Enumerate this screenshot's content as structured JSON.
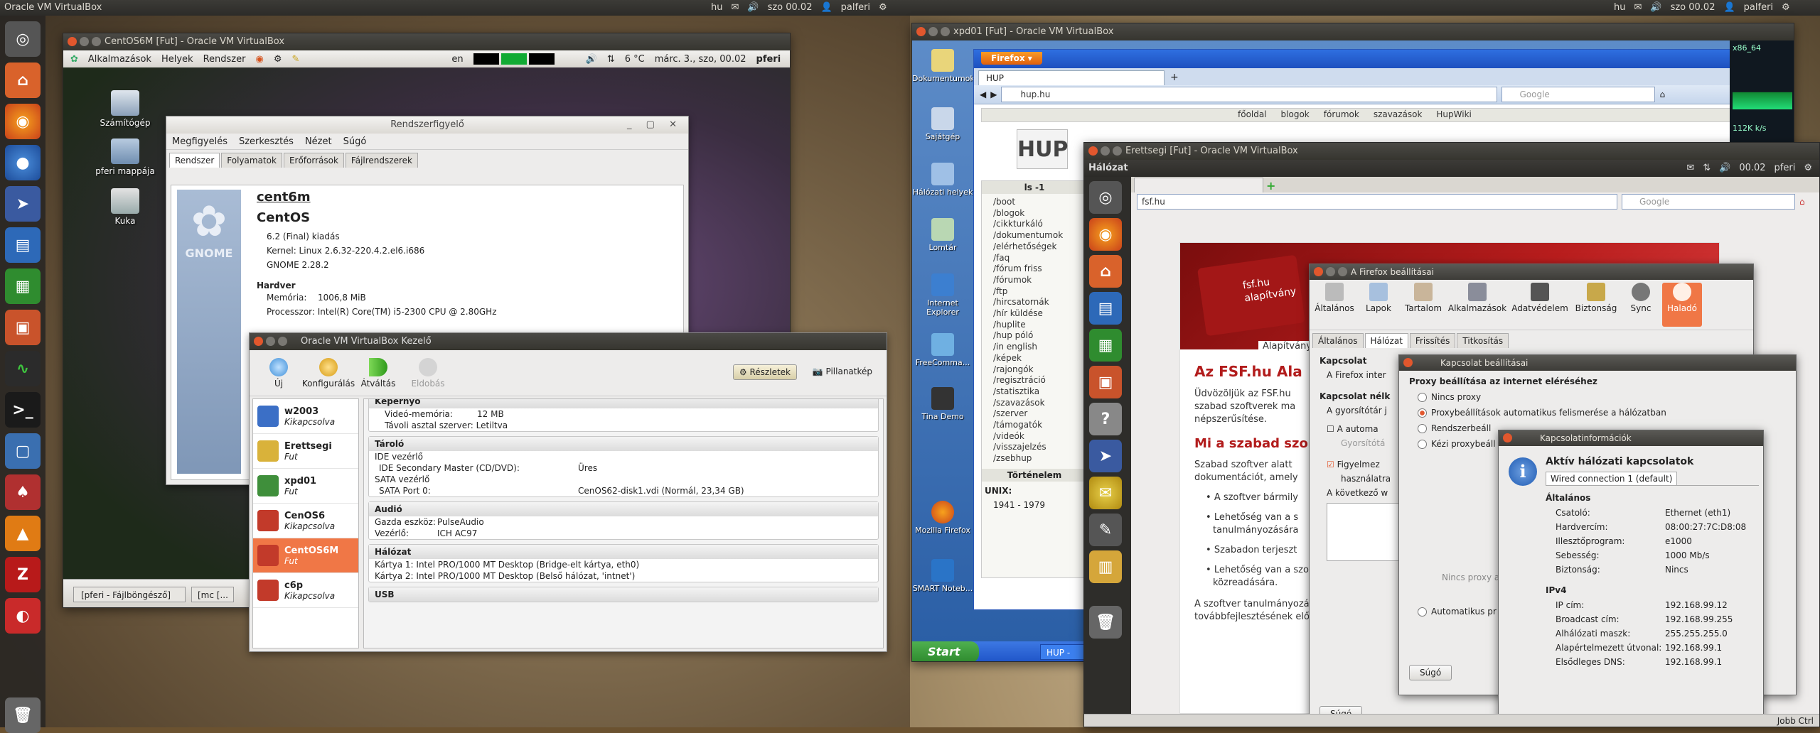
{
  "host_topbar": {
    "left_title": "Oracle VM VirtualBox",
    "left_tray": {
      "kbd": "hu",
      "clock": "szo 00.02",
      "user": "palferi"
    },
    "right_tray": {
      "kbd": "hu",
      "clock": "szo 00.02",
      "user": "palferi"
    }
  },
  "centos_vm": {
    "title": "CentOS6M [Fut] - Oracle VM VirtualBox",
    "panel": {
      "menus": [
        "Alkalmazások",
        "Helyek",
        "Rendszer"
      ],
      "kbd": "en",
      "weather": "6 °C",
      "datetime": "márc. 3., szo, 00.02",
      "user": "pferi"
    },
    "desktop_icons": [
      "Számítógép",
      "pferi mappája",
      "Kuka"
    ],
    "sysmon": {
      "title": "Rendszerfigyelő",
      "menus": [
        "Megfigyelés",
        "Szerkesztés",
        "Nézet",
        "Súgó"
      ],
      "tabs": [
        "Rendszer",
        "Folyamatok",
        "Erőforrások",
        "Fájlrendszerek"
      ],
      "hostname": "cent6m",
      "distro": "CentOS",
      "release": "6.2 (Final) kiadás",
      "kernel": "Kernel: Linux 2.6.32-220.4.2.el6.i686",
      "gnome": "GNOME 2.28.2",
      "hw_heading": "Hardver",
      "memory_label": "Memória:",
      "memory_value": "1006,8 MiB",
      "cpu_label": "Processzor:",
      "cpu_value": "Intel(R) Core(TM) i5-2300 CPU @ 2.80GHz",
      "gnome_logo_text": "GNOME"
    },
    "taskbar": [
      "[pferi - Fájlböngésző]",
      "[mc [..."
    ]
  },
  "vbox_manager": {
    "title": "Oracle VM VirtualBox Kezelő",
    "toolbar": {
      "new": "Új",
      "settings": "Konfigurálás",
      "start": "Átváltás",
      "discard": "Eldobás",
      "details": "Részletek",
      "snapshots": "Pillanatkép"
    },
    "vms": [
      {
        "name": "w2003",
        "state": "Kikapcsolva",
        "color": "#3b6fc6"
      },
      {
        "name": "Erettsegi",
        "state": "Fut",
        "color": "#d9b23a"
      },
      {
        "name": "xpd01",
        "state": "Fut",
        "color": "#3f8f3b"
      },
      {
        "name": "CenOS6",
        "state": "Kikapcsolva",
        "color": "#c23a2a"
      },
      {
        "name": "CentOS6M",
        "state": "Fut",
        "color": "#c23a2a"
      },
      {
        "name": "c6p",
        "state": "Kikapcsolva",
        "color": "#c23a2a"
      }
    ],
    "details": {
      "display": {
        "heading": "Képernyő",
        "vram_k": "Videó-memória:",
        "vram_v": "12 MB",
        "rdp": "Távoli asztal szerver: Letiltva"
      },
      "storage": {
        "heading": "Tároló",
        "ide": "IDE vezérlő",
        "ide_dev_k": "IDE Secondary Master (CD/DVD):",
        "ide_dev_v": "Üres",
        "sata": "SATA vezérlő",
        "sata_k": "SATA Port 0:",
        "sata_v": "CenOS62-disk1.vdi (Normál, 23,34 GB)"
      },
      "audio": {
        "heading": "Audió",
        "host_k": "Gazda eszköz:",
        "host_v": "PulseAudio",
        "ctrl_k": "Vezérlő:",
        "ctrl_v": "ICH AC97"
      },
      "network": {
        "heading": "Hálózat",
        "nic1": "Kártya 1: Intel PRO/1000 MT Desktop (Bridge-elt kártya, eth0)",
        "nic2": "Kártya 2: Intel PRO/1000 MT Desktop (Belső hálózat, 'intnet')"
      },
      "usb": {
        "heading": "USB"
      }
    }
  },
  "xpd01_vm": {
    "title": "xpd01 [Fut] - Oracle VM VirtualBox",
    "xp_icons": [
      "Dokumentumok",
      "Sajátgép",
      "Hálózati helyek",
      "Lomtár",
      "Internet Explorer",
      "FreeComma...",
      "Tina Demo",
      "Mozilla Firefox",
      "SMART Noteb..."
    ],
    "firefox": {
      "button": "Firefox",
      "tab": "HUP",
      "url": "hup.hu",
      "search_placeholder": "Google",
      "hup_nav": [
        "főoldal",
        "blogok",
        "fórumok",
        "szavazások",
        "HupWiki"
      ],
      "ls_heading": "ls -1",
      "ls_items": [
        "/boot",
        "/blogok",
        "/cikkturkáló",
        "/dokumentumok",
        "/elérhetőségek",
        "/faq",
        "/fórum friss",
        "/fórumok",
        "/ftp",
        "/hircsatornák",
        "/hír küldése",
        "/huplite",
        "/hup póló",
        "/in english",
        "/képek",
        "/rajongók",
        "/regisztráció",
        "/statisztika",
        "/szavazások",
        "/szerver",
        "/támogatók",
        "/videók",
        "/visszajelzés",
        "/zsebhup"
      ],
      "history_heading": "Történelem",
      "unix_label": "UNIX:",
      "unix_item": "1941 - 1979"
    },
    "taskbar": {
      "start": "Start",
      "task": "HUP -"
    },
    "clock": "x86_64",
    "net_speed": "112K k/s"
  },
  "erettsegi_vm": {
    "title": "Erettsegi [Fut] - Oracle VM VirtualBox",
    "panel_title": "Hálózat",
    "clock": "00.02",
    "user": "pferi",
    "url": "fsf.hu",
    "search_placeholder": "Google",
    "fsf": {
      "logo1": "fsf.hu",
      "logo2": "alapítvány",
      "logo_caption": "Alapítvány",
      "h1": "Az FSF.hu Ala",
      "p1a": "Üdvözöljük az FSF.hu",
      "p1b": "szabad szoftverek ma",
      "p1c": "népszerűsítése.",
      "h2": "Mi a szabad szo",
      "p2a": "Szabad szoftver alatt",
      "p2b": "dokumentációt, amely",
      "b1": "A szoftver bármily",
      "b2a": "Lehetőség van a s",
      "b2b": "tanulmányozására",
      "b3": "Szabadon terjeszt",
      "b4a": "Lehetőség van a szoftver továbbfej",
      "b4b": "közreadására.",
      "p3a": "A szoftver tanulmányozásának, módosít",
      "p3b": "továbbfejlesztésének előfeltétele a forráskód elérhetősége"
    },
    "prefs": {
      "title": "A Firefox beállításai",
      "cats": [
        "Általános",
        "Lapok",
        "Tartalom",
        "Alkalmazások",
        "Adatvédelem",
        "Biztonság",
        "Sync",
        "Haladó"
      ],
      "subtabs": [
        "Általános",
        "Hálózat",
        "Frissítés",
        "Titkosítás"
      ],
      "conn_heading": "Kapcsolat",
      "conn_text": "A Firefox inter",
      "offline_heading": "Kapcsolat nélk",
      "offline_text": "A gyorsítótár j",
      "auto_text": "A automa",
      "cache_text": "Gyorsítótá",
      "warn_a": "Figyelmez",
      "warn_b": "használatra",
      "next_text": "A következő w",
      "help": "Súgó"
    },
    "proxy": {
      "title": "Kapcsolat beállításai",
      "heading": "Proxy beállítása az internet eléréséhez",
      "options": [
        "Nincs proxy",
        "Proxybeállítások automatikus felismerése a hálózatban",
        "Rendszerbeáll",
        "Kézi proxybeáll"
      ],
      "noproxy": "Nincs proxy a",
      "auto": "Automatikus pr",
      "help": "Súgó"
    },
    "conninfo": {
      "title": "Kapcsolatinformációk",
      "heading": "Aktív hálózati kapcsolatok",
      "tab": "Wired connection 1 (default)",
      "general": "Általános",
      "rows": [
        {
          "k": "Csatoló:",
          "v": "Ethernet (eth1)"
        },
        {
          "k": "Hardvercím:",
          "v": "08:00:27:7C:D8:08"
        },
        {
          "k": "Illesztőprogram:",
          "v": "e1000"
        },
        {
          "k": "Sebesség:",
          "v": "1000 Mb/s"
        },
        {
          "k": "Biztonság:",
          "v": "Nincs"
        }
      ],
      "ipv4": "IPv4",
      "rows4": [
        {
          "k": "IP cím:",
          "v": "192.168.99.12"
        },
        {
          "k": "Broadcast cím:",
          "v": "192.168.99.255"
        },
        {
          "k": "Alhálózati maszk:",
          "v": "255.255.255.0"
        },
        {
          "k": "Alapértelmezett útvonal:",
          "v": "192.168.99.1"
        },
        {
          "k": "Elsődleges DNS:",
          "v": "192.168.99.1"
        }
      ]
    },
    "status_hotkey": "Jobb Ctrl"
  }
}
